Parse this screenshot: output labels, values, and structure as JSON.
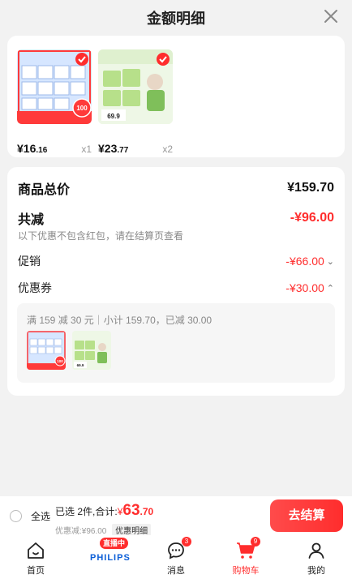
{
  "header": {
    "title": "金额明细"
  },
  "products": [
    {
      "price_int": "16",
      "price_dec": ".16",
      "qty": "x1",
      "thumb_color": "#e8f1ff",
      "badge": "100"
    },
    {
      "price_int": "23",
      "price_dec": ".77",
      "qty": "x2",
      "thumb_color": "#e6f3d8",
      "badge": "69.9"
    }
  ],
  "summary": {
    "total_label": "商品总价",
    "total_value": "¥159.70",
    "reduce_label": "共减",
    "reduce_value": "-¥96.00",
    "reduce_note": "以下优惠不包含红包，请在结算页查看",
    "promo_label": "促销",
    "promo_value": "-¥66.00",
    "coupon_label": "优惠券",
    "coupon_value": "-¥30.00",
    "coupon_desc": "满 159 减 30 元｜小计 159.70，已减 30.00"
  },
  "checkout": {
    "select_all": "全选",
    "selected_prefix": "已选 2件,合计:",
    "yen": "¥",
    "amount_int": "63",
    "amount_dec": ".70",
    "discount_text": "优惠减:¥96.00",
    "detail_pill": "优惠明细",
    "pay_label": "去结算"
  },
  "tabbar": {
    "home": "首页",
    "live_tag": "直播中",
    "brand": "PHILIPS",
    "messages": "消息",
    "messages_badge": "3",
    "cart": "购物车",
    "cart_badge": "9",
    "mine": "我的"
  },
  "colors": {
    "accent": "#ff2d2d"
  }
}
